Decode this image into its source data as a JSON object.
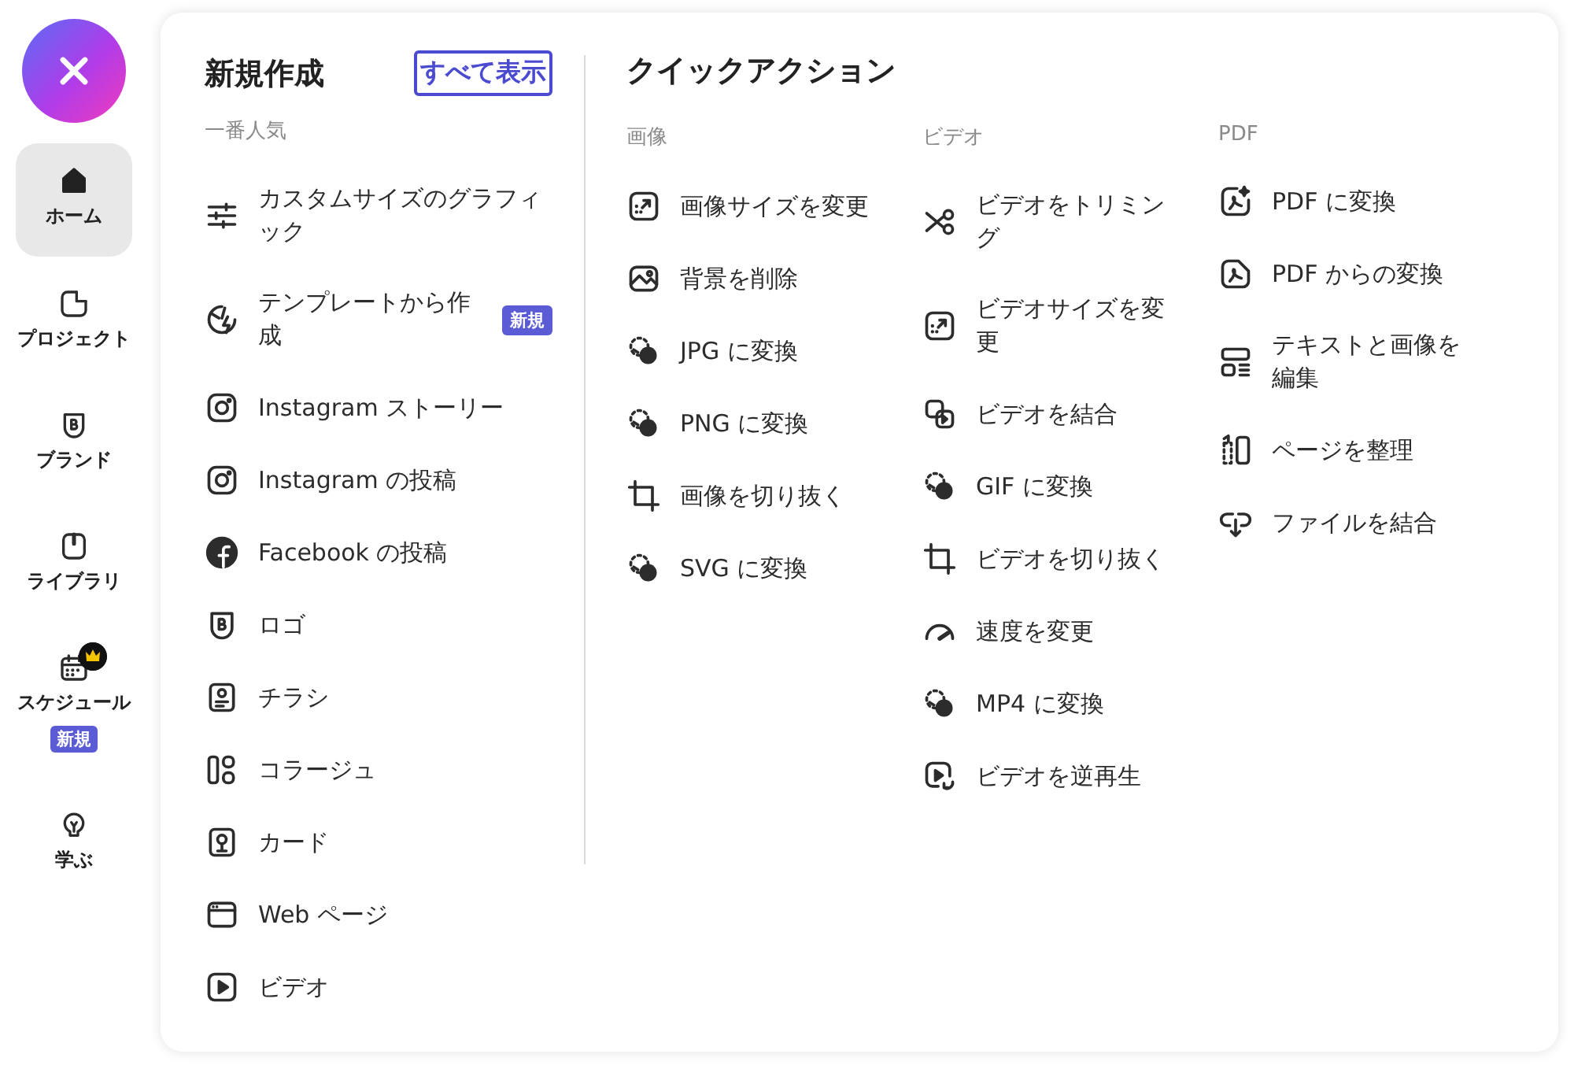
{
  "sidebar": {
    "items": [
      {
        "label": "ホーム",
        "selected": true,
        "premium": false
      },
      {
        "label": "プロジェクト",
        "selected": false,
        "premium": false
      },
      {
        "label": "ブランド",
        "selected": false,
        "premium": false
      },
      {
        "label": "ライブラリ",
        "selected": false,
        "premium": false
      },
      {
        "label": "スケジュール",
        "selected": false,
        "premium": true,
        "badge": "新規"
      },
      {
        "label": "学ぶ",
        "selected": false,
        "premium": false
      }
    ]
  },
  "new_section": {
    "title": "新規作成",
    "see_all": "すべて表示",
    "subtitle": "一番人気",
    "items": [
      {
        "label": "カスタムサイズのグラフィック"
      },
      {
        "label": "テンプレートから作成",
        "badge": "新規"
      },
      {
        "label": "Instagram ストーリー"
      },
      {
        "label": "Instagram の投稿"
      },
      {
        "label": "Facebook の投稿"
      },
      {
        "label": "ロゴ"
      },
      {
        "label": "チラシ"
      },
      {
        "label": "コラージュ"
      },
      {
        "label": "カード"
      },
      {
        "label": "Web ページ"
      },
      {
        "label": "ビデオ"
      }
    ]
  },
  "quick_actions": {
    "title": "クイックアクション",
    "columns": [
      {
        "heading": "画像",
        "items": [
          "画像サイズを変更",
          "背景を削除",
          "JPG に変換",
          "PNG に変換",
          "画像を切り抜く",
          "SVG に変換"
        ]
      },
      {
        "heading": "ビデオ",
        "items": [
          "ビデオをトリミング",
          "ビデオサイズを変更",
          "ビデオを結合",
          "GIF に変換",
          "ビデオを切り抜く",
          "速度を変更",
          "MP4 に変換",
          "ビデオを逆再生"
        ]
      },
      {
        "heading": "PDF",
        "items": [
          "PDF に変換",
          "PDF からの変換",
          "テキストと画像を編集",
          "ページを整理",
          "ファイルを結合"
        ]
      }
    ]
  }
}
